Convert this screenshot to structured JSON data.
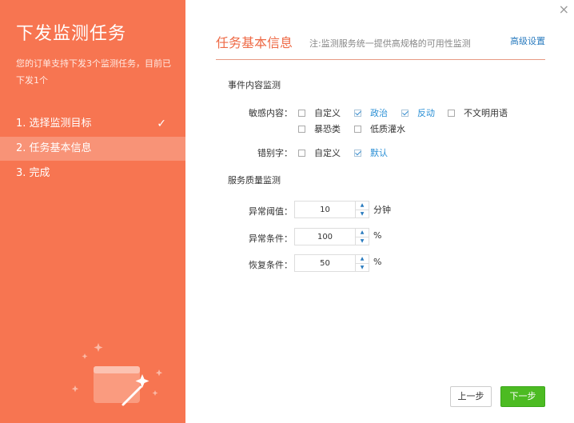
{
  "sidebar": {
    "title": "下发监测任务",
    "desc": "您的订单支持下发3个监测任务，目前已下发1个",
    "steps": [
      {
        "label": "1. 选择监测目标",
        "done": true
      },
      {
        "label": "2. 任务基本信息"
      },
      {
        "label": "3. 完成"
      }
    ],
    "check_icon": "✓"
  },
  "close_icon": "×",
  "header": {
    "title": "任务基本信息",
    "note": "注:监测服务统一提供高规格的可用性监测",
    "advanced_link": "高级设置"
  },
  "event_section": {
    "heading": "事件内容监测",
    "sensitive_label": "敏感内容：",
    "sensitive_options": [
      {
        "label": "自定义",
        "checked": false
      },
      {
        "label": "政治",
        "checked": true
      },
      {
        "label": "反动",
        "checked": true
      },
      {
        "label": "不文明用语",
        "checked": false
      },
      {
        "label": "暴恐类",
        "checked": false
      },
      {
        "label": "低质灌水",
        "checked": false
      }
    ],
    "typo_label": "错别字：",
    "typo_options": [
      {
        "label": "自定义",
        "checked": false
      },
      {
        "label": "默认",
        "checked": true
      }
    ]
  },
  "quality_section": {
    "heading": "服务质量监测",
    "rows": [
      {
        "label": "异常阈值：",
        "value": "10",
        "unit": "分钟"
      },
      {
        "label": "异常条件：",
        "value": "100",
        "unit": "%"
      },
      {
        "label": "恢复条件：",
        "value": "50",
        "unit": "%"
      }
    ],
    "up_icon": "▲",
    "down_icon": "▼"
  },
  "buttons": {
    "prev": "上一步",
    "next": "下一步"
  }
}
